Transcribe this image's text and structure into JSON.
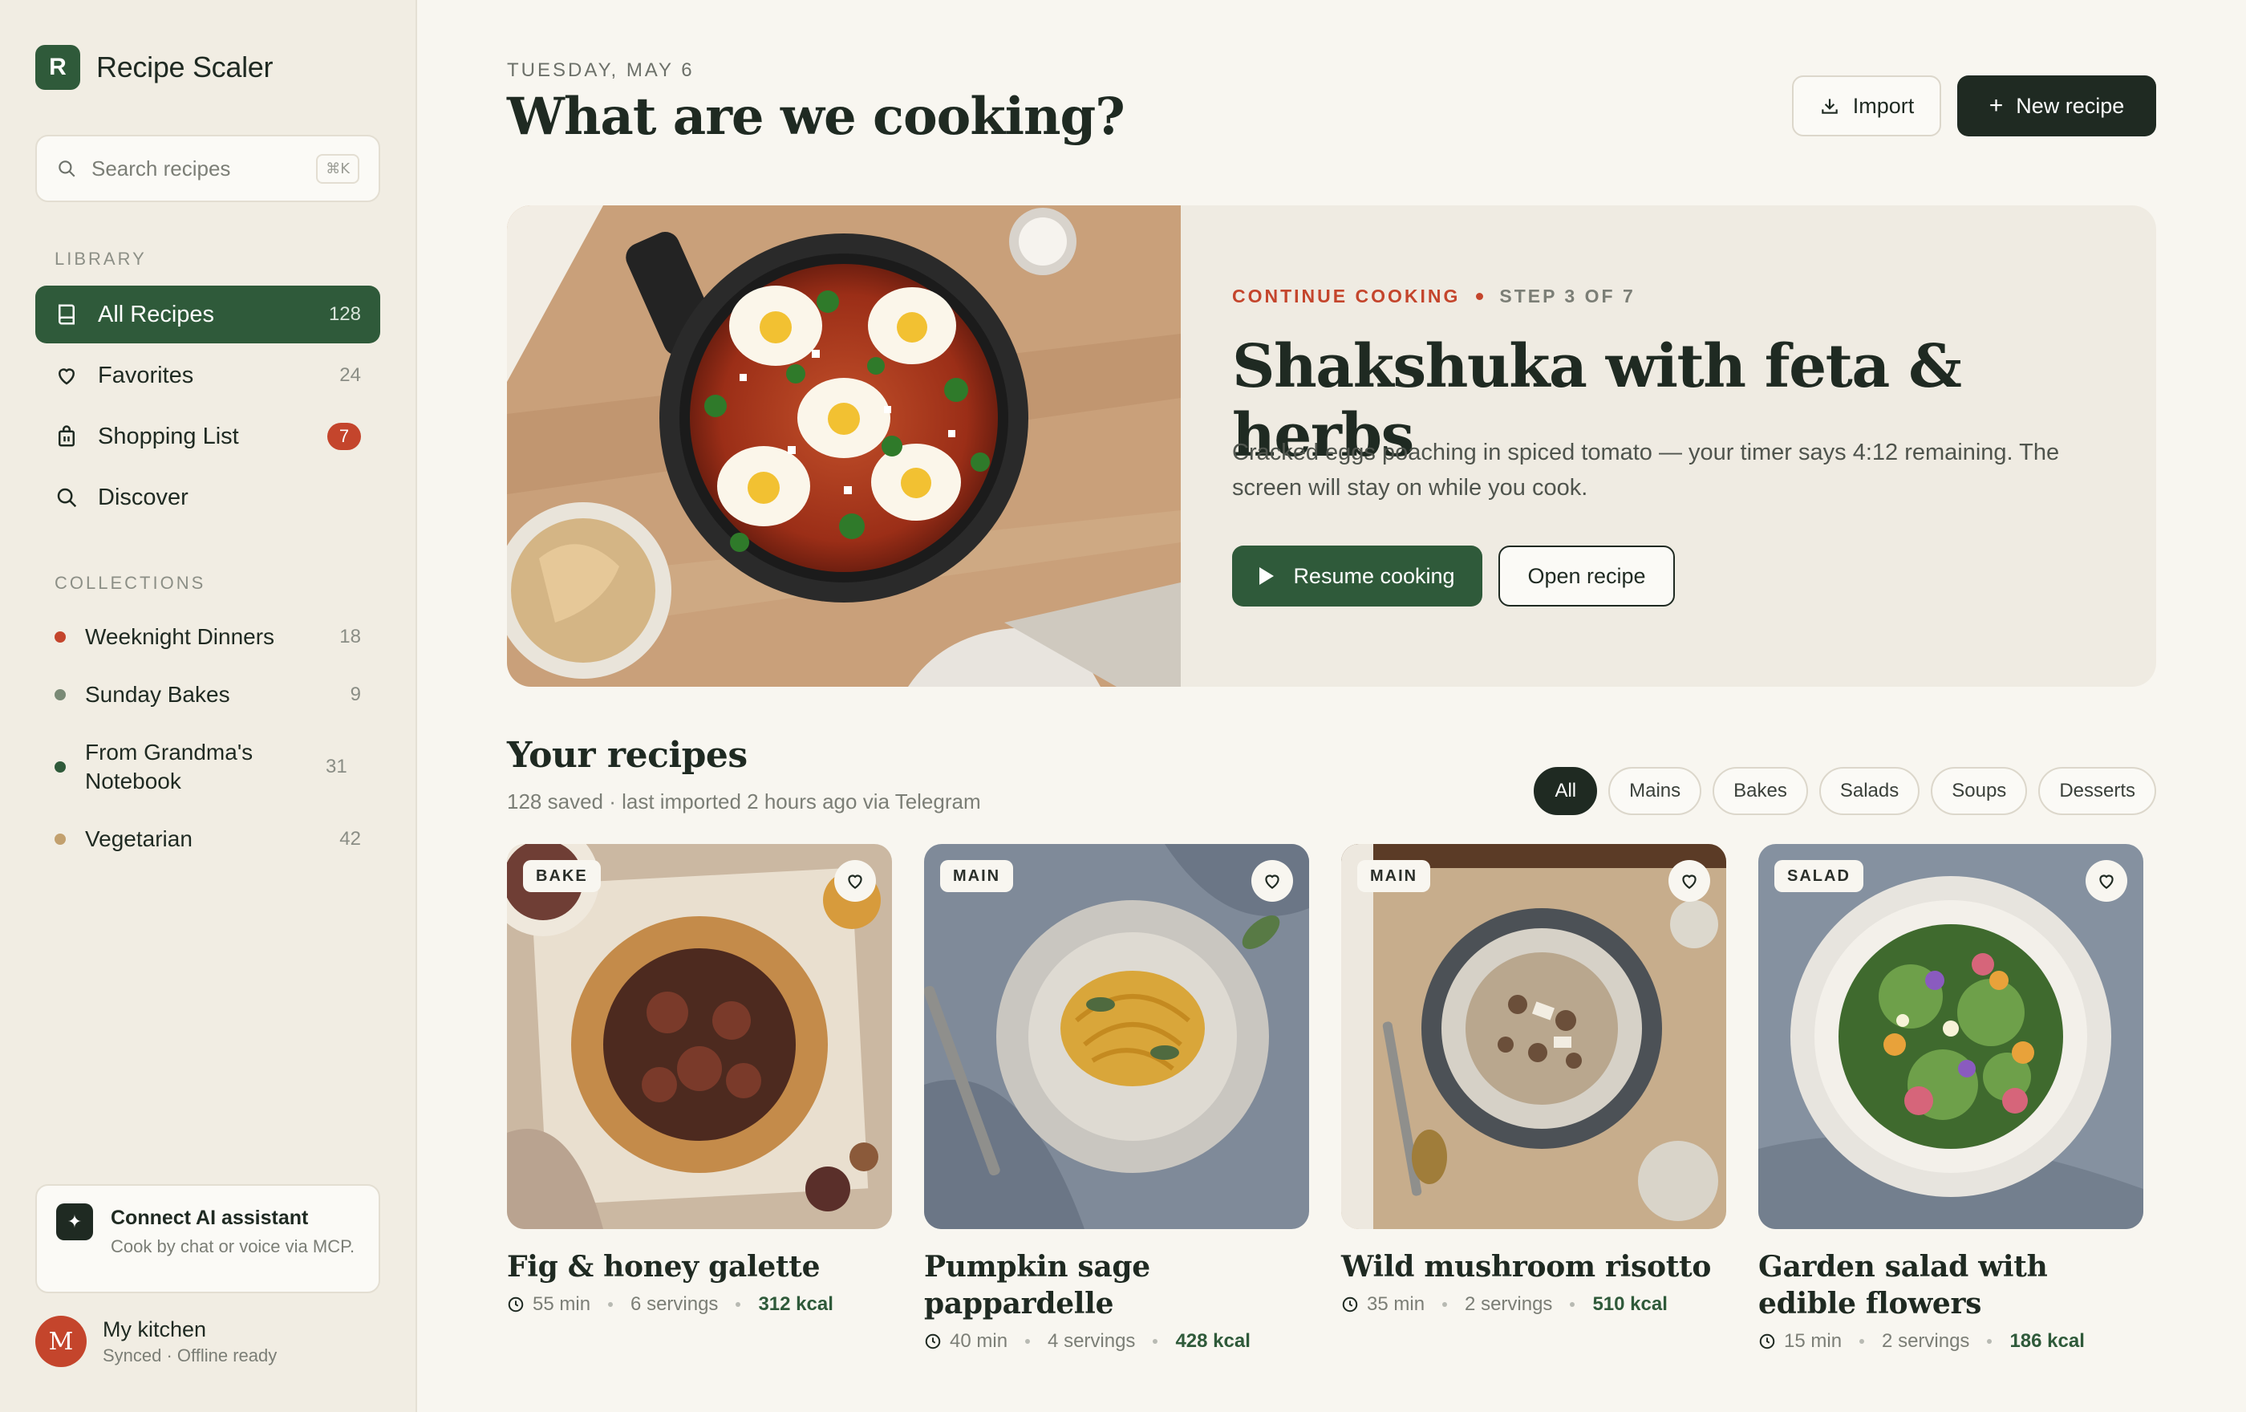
{
  "app": {
    "logo_letter": "R",
    "name": "Recipe Scaler"
  },
  "search": {
    "placeholder": "Search recipes",
    "shortcut": "⌘K"
  },
  "sidebar": {
    "library_label": "LIBRARY",
    "items": [
      {
        "label": "All Recipes",
        "count": "128",
        "icon": "book-icon",
        "active": true
      },
      {
        "label": "Favorites",
        "count": "24",
        "icon": "heart-icon"
      },
      {
        "label": "Shopping List",
        "count": "7",
        "icon": "shopping-bag-icon",
        "badge": true
      },
      {
        "label": "Discover",
        "icon": "search-icon"
      }
    ],
    "collections_label": "COLLECTIONS",
    "collections": [
      {
        "label": "Weeknight Dinners",
        "count": "18",
        "color": "#c4452c"
      },
      {
        "label": "Sunday Bakes",
        "count": "9",
        "color": "#7a8a76"
      },
      {
        "label": "From Grandma's Notebook",
        "count": "31",
        "color": "#2f5a3a"
      },
      {
        "label": "Vegetarian",
        "count": "42",
        "color": "#c2a06e"
      }
    ],
    "assistant": {
      "title": "Connect AI assistant",
      "subtitle": "Cook by chat or voice via MCP."
    },
    "profile": {
      "initial": "M",
      "name": "My kitchen",
      "status": "Synced · Offline ready"
    }
  },
  "header": {
    "date": "TUESDAY, MAY 6",
    "title": "What are we cooking?",
    "import_label": "Import",
    "new_label": "New recipe"
  },
  "hero": {
    "eyebrow": "CONTINUE COOKING",
    "step": "STEP 3 OF 7",
    "title": "Shakshuka with feta & herbs",
    "description": "Cracked eggs poaching in spiced tomato — your timer says 4:12 remaining. The screen will stay on while you cook.",
    "resume_label": "Resume cooking",
    "open_label": "Open recipe"
  },
  "recipes_section": {
    "title": "Your recipes",
    "subtitle": "128 saved · last imported 2 hours ago via Telegram",
    "filters": [
      "All",
      "Mains",
      "Bakes",
      "Salads",
      "Soups",
      "Desserts"
    ],
    "active_filter": "All"
  },
  "recipes": [
    {
      "tag": "BAKE",
      "title": "Fig & honey galette",
      "time": "55 min",
      "servings": "6 servings",
      "kcal": "312 kcal"
    },
    {
      "tag": "MAIN",
      "title": "Pumpkin sage pappardelle",
      "time": "40 min",
      "servings": "4 servings",
      "kcal": "428 kcal"
    },
    {
      "tag": "MAIN",
      "title": "Wild mushroom risotto",
      "time": "35 min",
      "servings": "2 servings",
      "kcal": "510 kcal"
    },
    {
      "tag": "SALAD",
      "title": "Garden salad with edible flowers",
      "time": "15 min",
      "servings": "2 servings",
      "kcal": "186 kcal"
    }
  ],
  "colors": {
    "accent": "#2f5a3a",
    "dark": "#1f2a22",
    "alert": "#c4452c",
    "background": "#f8f6f0"
  }
}
